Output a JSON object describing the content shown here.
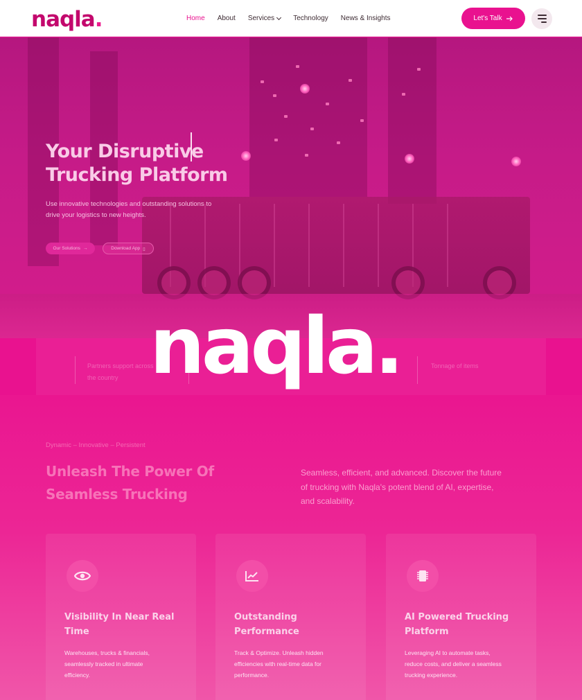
{
  "header": {
    "logo_text": "naqla",
    "logo_dot": ".",
    "nav": [
      {
        "label": "Home",
        "active": true
      },
      {
        "label": "About"
      },
      {
        "label": "Services",
        "has_dropdown": true
      },
      {
        "label": "Technology"
      },
      {
        "label": "News & Insights"
      }
    ],
    "cta_label": "Let's Talk",
    "cta_icon": "arrow-right-icon",
    "menu_icon": "hamburger-menu-icon"
  },
  "hero": {
    "title_line1": "Your Disruptive",
    "title_line2": "Trucking Platform",
    "subtitle": "Use innovative technologies and outstanding solutions to drive your logistics to new heights.",
    "button_primary": "Our Solutions",
    "button_secondary": "Download App"
  },
  "stats": {
    "items": [
      "Partners support across the country",
      "Tonnage of items"
    ]
  },
  "overlay_logo": {
    "text": "naqla",
    "dot": "."
  },
  "features": {
    "tagline": "Dynamic – Innovative – Persistent",
    "title": "Unleash The Power Of Seamless Trucking",
    "description": "Seamless, efficient, and advanced. Discover the future of trucking with Naqla's potent blend of AI, expertise, and scalability.",
    "cards": [
      {
        "icon": "eye-icon",
        "title": "Visibility In Near Real Time",
        "text": "Warehouses, trucks & financials, seamlessly tracked in ultimate efficiency."
      },
      {
        "icon": "chart-trend-icon",
        "title": "Outstanding Performance",
        "text": "Track & Optimize. Unleash hidden efficiencies with real-time data for performance."
      },
      {
        "icon": "chip-icon",
        "title": "AI Powered Trucking Platform",
        "text": "Leveraging AI to automate tasks, reduce costs, and deliver a seamless trucking experience."
      }
    ]
  },
  "colors": {
    "brand": "#e9128f",
    "brand_dark": "#c3086d"
  }
}
